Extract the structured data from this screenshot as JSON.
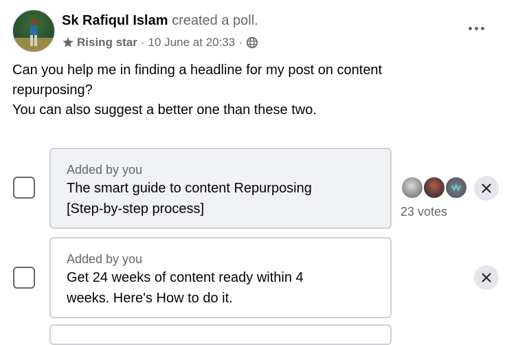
{
  "post": {
    "author": "Sk Rafiqul Islam",
    "action": "created a poll.",
    "badge": "Rising star",
    "separator": "·",
    "timestamp": "10 June at 20:33",
    "audience_icon": "globe-icon",
    "body_lines": [
      "Can you help me in finding a headline for my post on content",
      "repurposing?",
      "You can also suggest a better one than these two."
    ]
  },
  "poll": {
    "options": [
      {
        "added_by": "Added by you",
        "text_lines": [
          "The smart guide to content Repurposing",
          "[Step-by-step process]"
        ],
        "votes": "23 votes",
        "selected": false
      },
      {
        "added_by": "Added by you",
        "text_lines": [
          "Get 24 weeks of content ready within 4",
          "weeks. Here's How to do it."
        ],
        "votes": "",
        "selected": false
      }
    ]
  },
  "colors": {
    "text_primary": "#050505",
    "text_secondary": "#65676b",
    "card_border": "#ced0d4",
    "card_fill_voted": "#f0f2f5",
    "button_fill": "#e4e6eb"
  }
}
